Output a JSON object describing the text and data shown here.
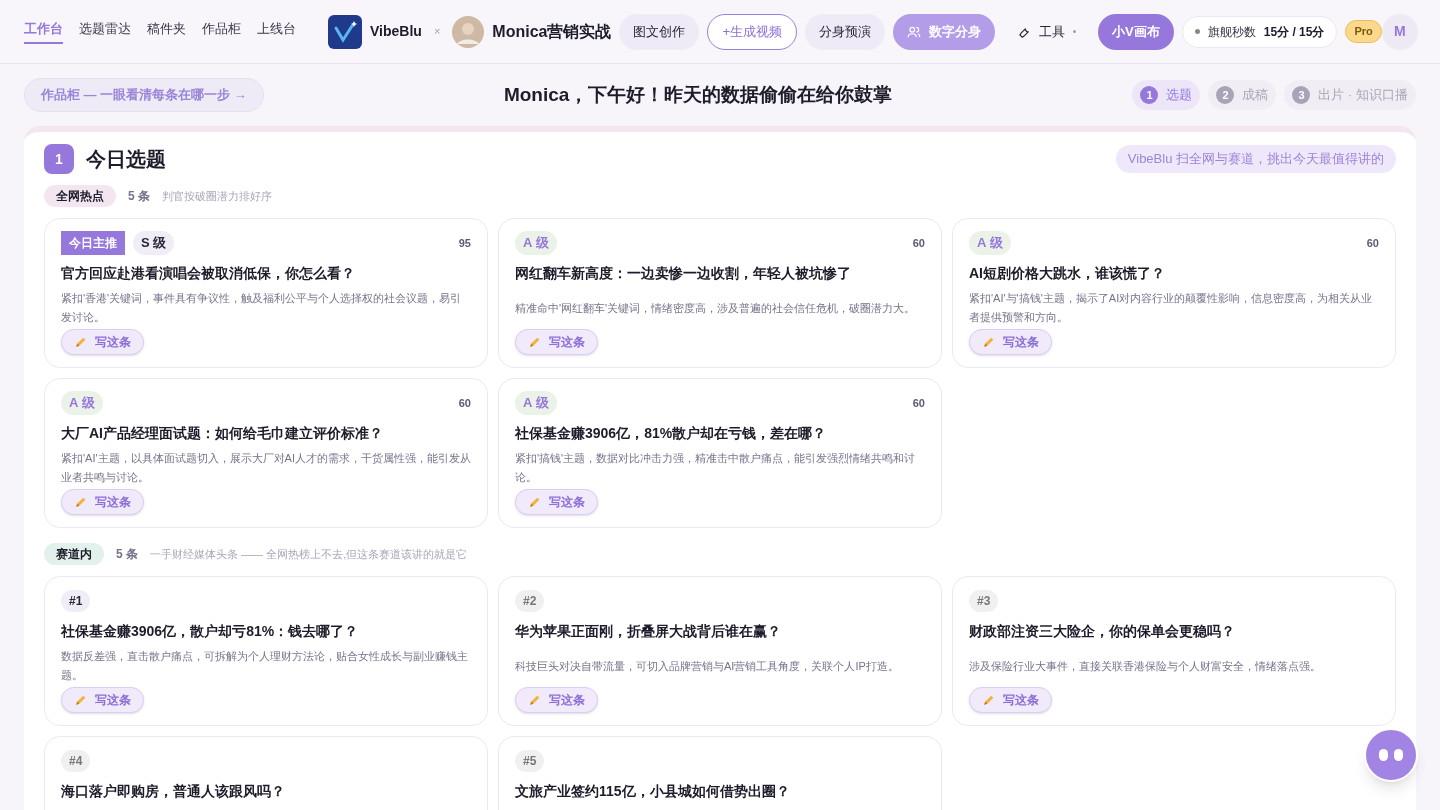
{
  "nav": {
    "tabs": [
      {
        "label": "工作台",
        "selected": true
      },
      {
        "label": "选题雷达",
        "selected": false
      },
      {
        "label": "稿件夹",
        "selected": false
      },
      {
        "label": "作品柜",
        "selected": false
      },
      {
        "label": "上线台",
        "selected": false
      }
    ],
    "brand": "VibeBlu",
    "separator": "×",
    "partner": "Monica营销实战",
    "buttons": [
      {
        "label": "图文创作",
        "kind": "soft"
      },
      {
        "label": "+生成视频",
        "kind": "outline"
      },
      {
        "label": "分身预演",
        "kind": "soft"
      },
      {
        "label": "数字分身",
        "kind": "accent"
      },
      {
        "label": "工具",
        "kind": "tool"
      },
      {
        "label": "小V画布",
        "kind": "primary"
      }
    ],
    "quota": {
      "label": "旗舰秒数",
      "value": "15分 / 15分"
    },
    "plan": "Pro",
    "avatar": "M"
  },
  "banner": {
    "link": "作品柜 — 一眼看清每条在哪一步 →",
    "greeting": "Monica，下午好！昨天的数据偷偷在给你鼓掌",
    "steps": [
      {
        "number": "1",
        "label": "选题",
        "selected": true
      },
      {
        "number": "2",
        "label": "成稿",
        "selected": false
      },
      {
        "number": "3",
        "label": "出片 · 知识口播",
        "selected": false
      }
    ]
  },
  "section": {
    "number": "1",
    "title": "今日选题",
    "note": "VibeBlu 扫全网与赛道，挑出今天最值得讲的",
    "groups": [
      {
        "tag": "全网热点",
        "count": "5 条",
        "hint": "判官按破圈潜力排好序",
        "color": "#f3e6f1",
        "cards": [
          {
            "kind": "hot",
            "featured": "今日主推",
            "grade": "S 级",
            "score": "95",
            "title": "官方回应赴港看演唱会被取消低保，你怎么看？",
            "desc": "紧扣'香港'关键词，事件具有争议性，触及福利公平与个人选择权的社会议题，易引发讨论。",
            "action": "写这条"
          },
          {
            "kind": "hot",
            "grade": "A 级",
            "score": "60",
            "title": "网红翻车新高度：一边卖惨一边收割，年轻人被坑惨了",
            "desc": "精准命中'网红翻车'关键词，情绪密度高，涉及普遍的社会信任危机，破圈潜力大。",
            "action": "写这条"
          },
          {
            "kind": "hot",
            "grade": "A 级",
            "score": "60",
            "title": "AI短剧价格大跳水，谁该慌了？",
            "desc": "紧扣'AI'与'搞钱'主题，揭示了AI对内容行业的颠覆性影响，信息密度高，为相关从业者提供预警和方向。",
            "action": "写这条"
          },
          {
            "kind": "hot",
            "grade": "A 级",
            "score": "60",
            "title": "大厂AI产品经理面试题：如何给毛巾建立评价标准？",
            "desc": "紧扣'AI'主题，以具体面试题切入，展示大厂对AI人才的需求，干货属性强，能引发从业者共鸣与讨论。",
            "action": "写这条"
          },
          {
            "kind": "hot",
            "grade": "A 级",
            "score": "60",
            "title": "社保基金赚3906亿，81%散户却在亏钱，差在哪？",
            "desc": "紧扣'搞钱'主题，数据对比冲击力强，精准击中散户痛点，能引发强烈情绪共鸣和讨论。",
            "action": "写这条"
          }
        ]
      },
      {
        "tag": "赛道内",
        "count": "5 条",
        "hint": "一手财经媒体头条 —— 全网热榜上不去,但这条赛道该讲的就是它",
        "color": "#e3f1ec",
        "cards": [
          {
            "kind": "lane",
            "rank": "#1",
            "title": "社保基金赚3906亿，散户却亏81%：钱去哪了？",
            "desc": "数据反差强，直击散户痛点，可拆解为个人理财方法论，贴合女性成长与副业赚钱主题。",
            "action": "写这条"
          },
          {
            "kind": "lane",
            "rank": "#2",
            "title": "华为苹果正面刚，折叠屏大战背后谁在赢？",
            "desc": "科技巨头对决自带流量，可切入品牌营销与AI营销工具角度，关联个人IP打造。",
            "action": "写这条"
          },
          {
            "kind": "lane",
            "rank": "#3",
            "title": "财政部注资三大险企，你的保单会更稳吗？",
            "desc": "涉及保险行业大事件，直接关联香港保险与个人财富安全，情绪落点强。",
            "action": "写这条"
          },
          {
            "kind": "lane",
            "rank": "#4",
            "title": "海口落户即购房，普通人该跟风吗？"
          },
          {
            "kind": "lane",
            "rank": "#5",
            "title": "文旅产业签约115亿，小县城如何借势出圈？"
          }
        ]
      }
    ]
  }
}
